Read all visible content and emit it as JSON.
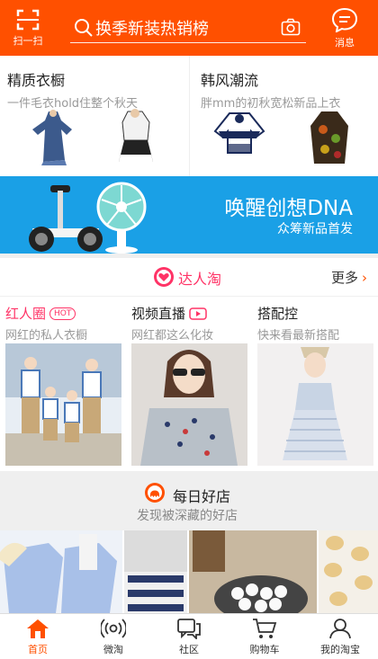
{
  "header": {
    "scan_label": "扫一扫",
    "search_query": "换季新装热销榜",
    "message_label": "消息"
  },
  "promos": [
    {
      "title": "精质衣橱",
      "subtitle": "一件毛衣hold住整个秋天"
    },
    {
      "title": "韩风潮流",
      "subtitle": "胖mm的初秋宽松新品上衣"
    }
  ],
  "banner": {
    "title": "唤醒创想DNA",
    "subtitle": "众筹新品首发"
  },
  "daren": {
    "title": "达人淘",
    "more_label": "更多",
    "columns": [
      {
        "title": "红人圈",
        "badge": "HOT",
        "subtitle": "网红的私人衣橱"
      },
      {
        "title": "视频直播",
        "subtitle": "网红都这么化妆"
      },
      {
        "title": "搭配控",
        "subtitle": "快来看最新搭配"
      }
    ]
  },
  "daily": {
    "title": "每日好店",
    "subtitle": "发现被深藏的好店"
  },
  "tabbar": [
    {
      "label": "首页",
      "icon": "home-icon",
      "active": true
    },
    {
      "label": "微淘",
      "icon": "broadcast-icon",
      "active": false
    },
    {
      "label": "社区",
      "icon": "community-icon",
      "active": false
    },
    {
      "label": "购物车",
      "icon": "cart-icon",
      "active": false
    },
    {
      "label": "我的淘宝",
      "icon": "user-icon",
      "active": false
    }
  ],
  "colors": {
    "brand": "#ff5000",
    "accent_pink": "#ff3366",
    "banner_blue": "#1aa0e6"
  }
}
